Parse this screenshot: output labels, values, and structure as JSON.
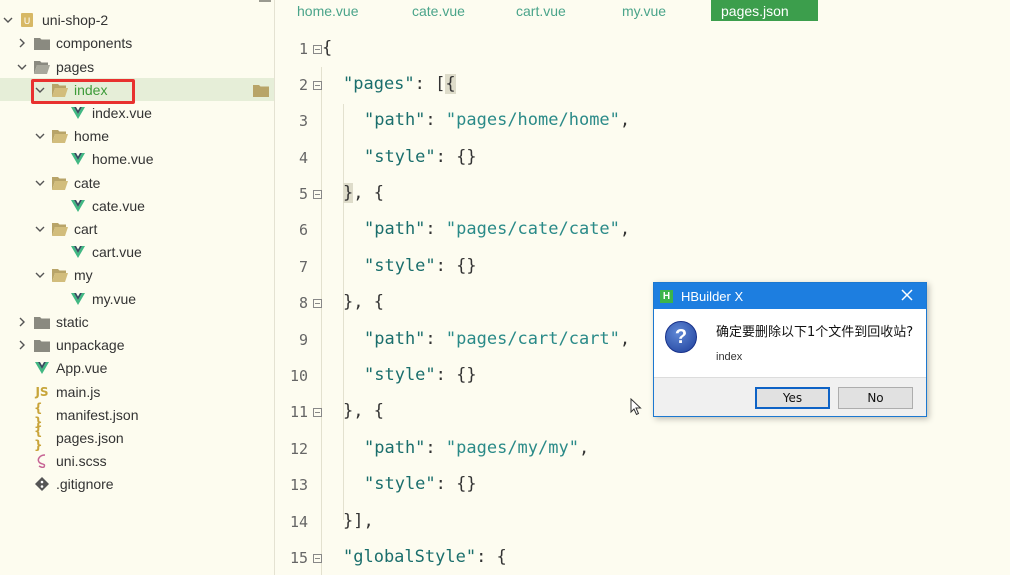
{
  "sidebar": {
    "items": [
      {
        "label": "uni-shop-2",
        "icon": "project-icon",
        "expanded": true
      },
      {
        "label": "components",
        "icon": "folder-icon",
        "expanded": false
      },
      {
        "label": "pages",
        "icon": "folder-open-icon",
        "expanded": true
      },
      {
        "label": "index",
        "icon": "folder-open-icon",
        "expanded": true,
        "selected": true
      },
      {
        "label": "index.vue",
        "icon": "vue-icon"
      },
      {
        "label": "home",
        "icon": "folder-open-icon",
        "expanded": true
      },
      {
        "label": "home.vue",
        "icon": "vue-icon"
      },
      {
        "label": "cate",
        "icon": "folder-open-icon",
        "expanded": true
      },
      {
        "label": "cate.vue",
        "icon": "vue-icon"
      },
      {
        "label": "cart",
        "icon": "folder-open-icon",
        "expanded": true
      },
      {
        "label": "cart.vue",
        "icon": "vue-icon"
      },
      {
        "label": "my",
        "icon": "folder-open-icon",
        "expanded": true
      },
      {
        "label": "my.vue",
        "icon": "vue-icon"
      },
      {
        "label": "static",
        "icon": "folder-icon",
        "expanded": false
      },
      {
        "label": "unpackage",
        "icon": "folder-icon",
        "expanded": false
      },
      {
        "label": "App.vue",
        "icon": "vue-icon"
      },
      {
        "label": "main.js",
        "icon": "js-icon",
        "icon_text": "JS"
      },
      {
        "label": "manifest.json",
        "icon": "json-icon",
        "icon_text": "{ }"
      },
      {
        "label": "pages.json",
        "icon": "json-icon",
        "icon_text": "{ }"
      },
      {
        "label": "uni.scss",
        "icon": "scss-icon"
      },
      {
        "label": ".gitignore",
        "icon": "git-icon"
      }
    ]
  },
  "tabs": [
    {
      "label": "home.vue",
      "active": false
    },
    {
      "label": "cate.vue",
      "active": false
    },
    {
      "label": "cart.vue",
      "active": false
    },
    {
      "label": "my.vue",
      "active": false
    },
    {
      "label": "pages.json",
      "active": true
    }
  ],
  "editor": {
    "lines": [
      {
        "num": "1",
        "fold": true,
        "text": "{"
      },
      {
        "num": "2",
        "fold": true,
        "text": "\"pages\": [{"
      },
      {
        "num": "3",
        "fold": false,
        "text": "\"path\": \"pages/home/home\","
      },
      {
        "num": "4",
        "fold": false,
        "text": "\"style\": {}"
      },
      {
        "num": "5",
        "fold": true,
        "text": "}, {"
      },
      {
        "num": "6",
        "fold": false,
        "text": "\"path\": \"pages/cate/cate\","
      },
      {
        "num": "7",
        "fold": false,
        "text": "\"style\": {}"
      },
      {
        "num": "8",
        "fold": true,
        "text": "}, {"
      },
      {
        "num": "9",
        "fold": false,
        "text": "\"path\": \"pages/cart/cart\","
      },
      {
        "num": "10",
        "fold": false,
        "text": "\"style\": {}"
      },
      {
        "num": "11",
        "fold": true,
        "text": "}, {"
      },
      {
        "num": "12",
        "fold": false,
        "text": "\"path\": \"pages/my/my\","
      },
      {
        "num": "13",
        "fold": false,
        "text": "\"style\": {}"
      },
      {
        "num": "14",
        "fold": false,
        "text": "}],"
      },
      {
        "num": "15",
        "fold": true,
        "text": "\"globalStyle\": {"
      }
    ]
  },
  "dialog": {
    "title": "HBuilder X",
    "title_icon": "H",
    "message": "确定要删除以下1个文件到回收站?",
    "filename": "index",
    "yes_label": "Yes",
    "no_label": "No",
    "icon": "question-icon"
  },
  "colors": {
    "accent": "#3c9e4c",
    "dialog_title": "#1d7ee0",
    "selection_box": "#e8312f",
    "key": "#1a6e6c",
    "string": "#2a8a88"
  }
}
